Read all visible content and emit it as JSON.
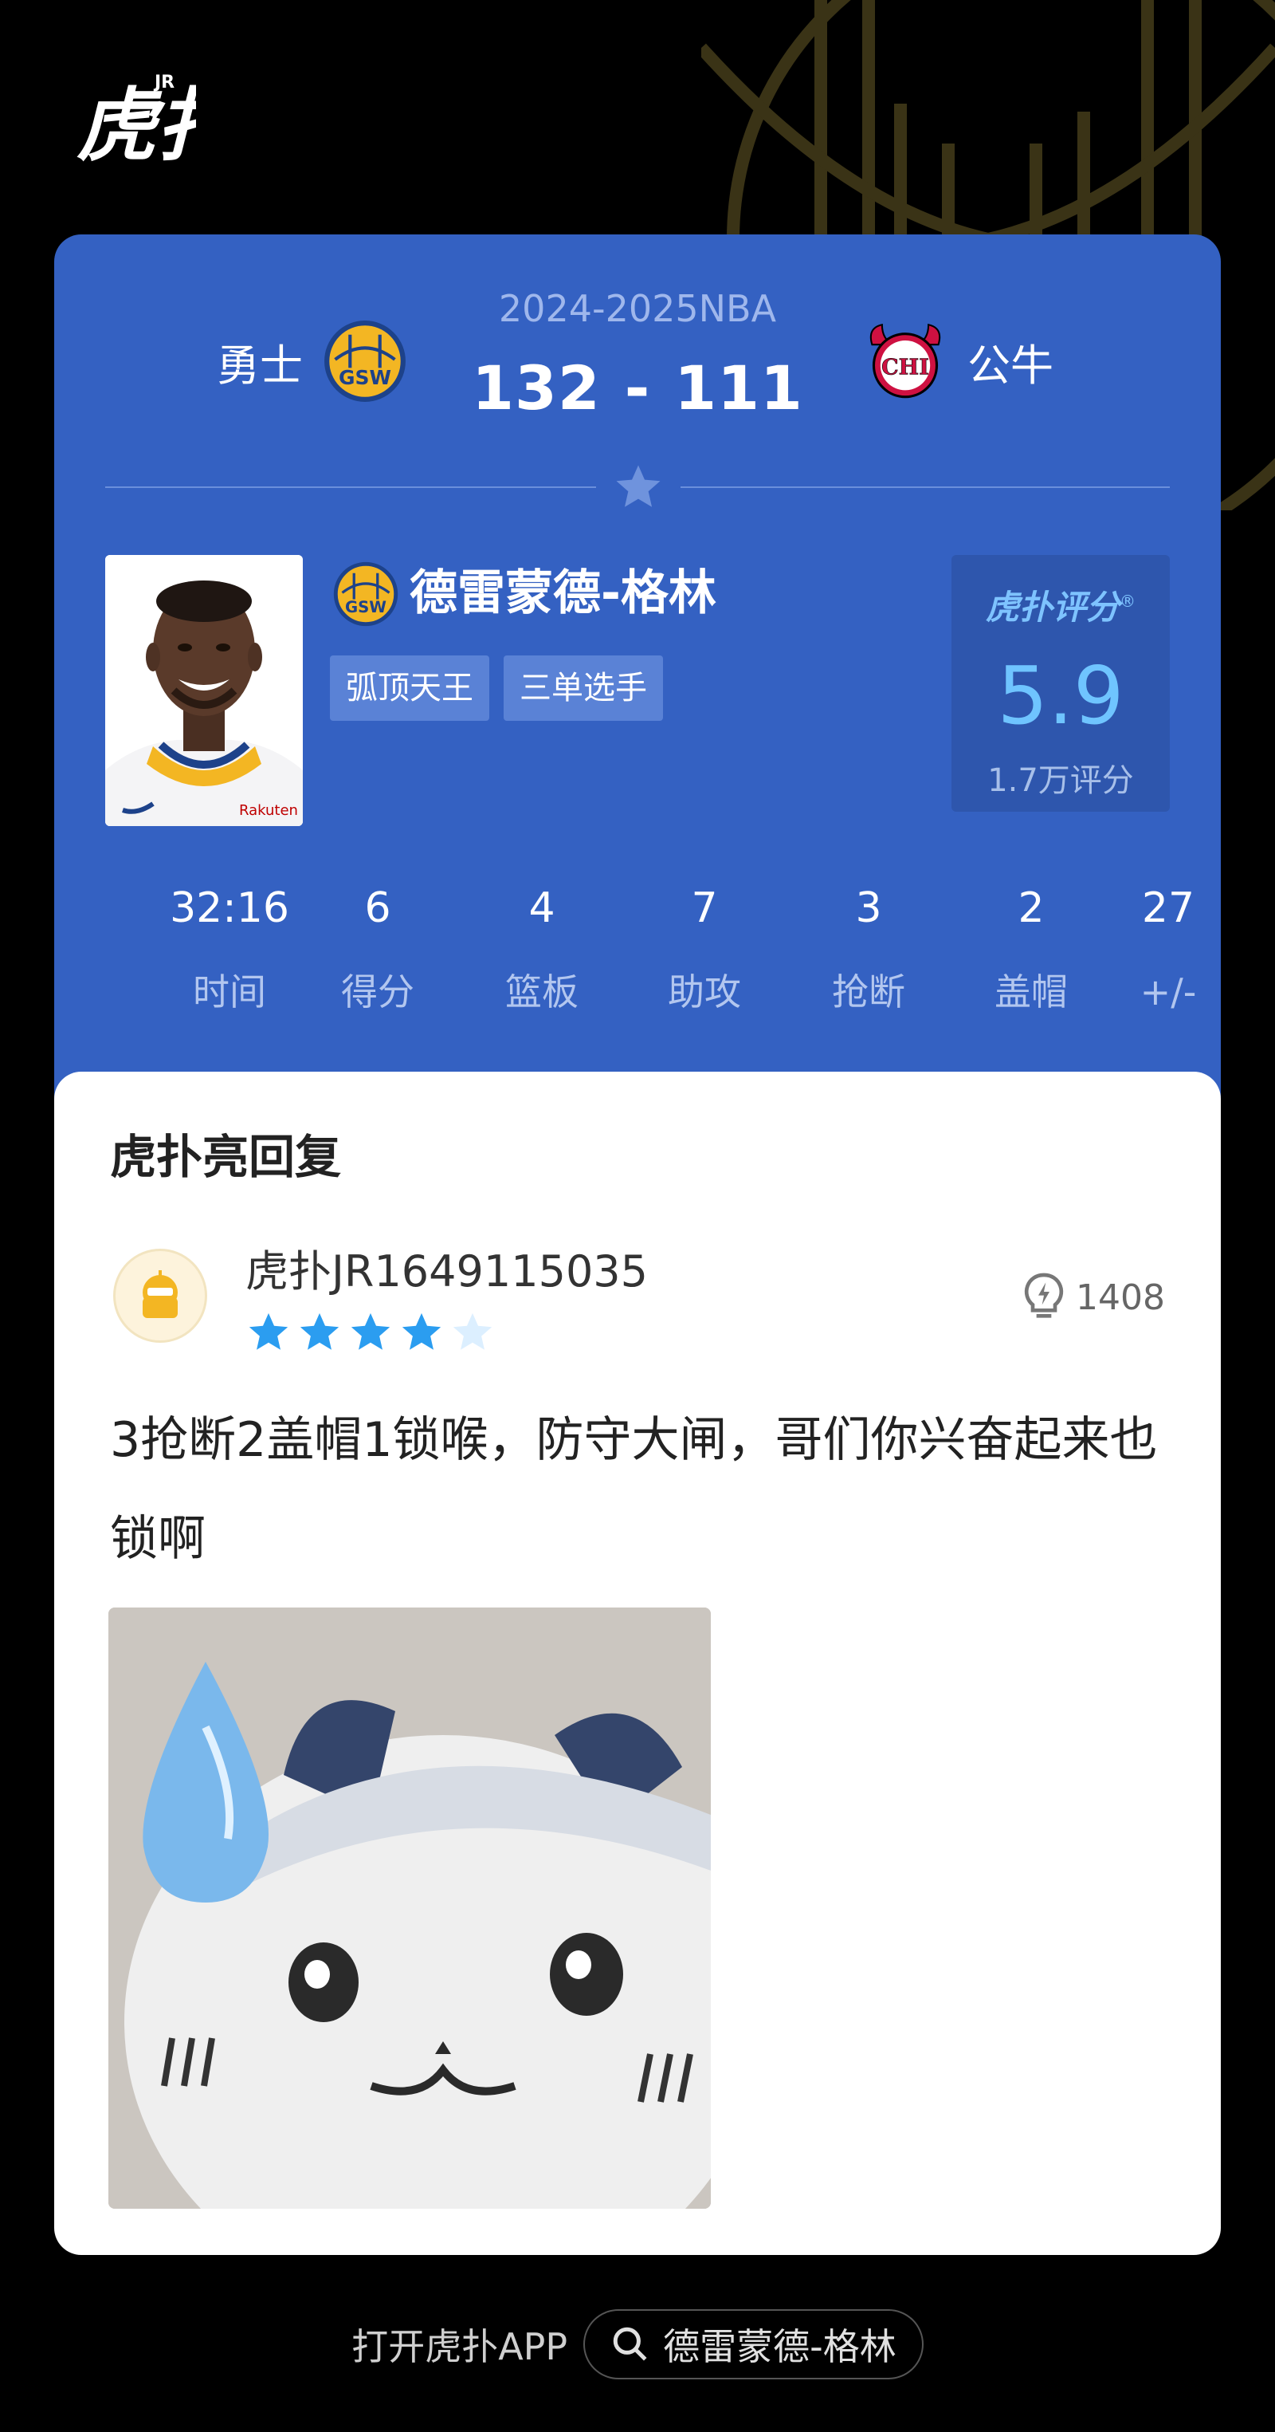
{
  "brand": {
    "logo_text": "虎扑",
    "logo_sup": "JR"
  },
  "match": {
    "home_team": "勇士",
    "home_abbr": "GSW",
    "away_team": "公牛",
    "away_abbr": "CHI",
    "season": "2024-2025NBA",
    "home_score": "132",
    "separator": "-",
    "away_score": "111"
  },
  "player": {
    "name": "德雷蒙德-格林",
    "team_abbr": "GSW",
    "tags": [
      "弧顶天王",
      "三单选手"
    ],
    "jersey_sponsor": "Rakuten"
  },
  "rating": {
    "brand": "虎扑评分",
    "registered": "®",
    "score": "5.9",
    "count": "1.7万评分"
  },
  "stats": [
    {
      "value": "32:16",
      "label": "时间"
    },
    {
      "value": "6",
      "label": "得分"
    },
    {
      "value": "4",
      "label": "篮板"
    },
    {
      "value": "7",
      "label": "助攻"
    },
    {
      "value": "3",
      "label": "抢断"
    },
    {
      "value": "2",
      "label": "盖帽"
    },
    {
      "value": "27",
      "label": "+/-"
    }
  ],
  "reply": {
    "section_title": "虎扑亮回复",
    "username": "虎扑JR1649115035",
    "star_rating": 4,
    "star_max": 5,
    "likes": "1408",
    "text": "3抢断2盖帽1锁喉，防守大闸，哥们你兴奋起来也锁啊"
  },
  "footer": {
    "open_app": "打开虎扑APP",
    "search_text": "德雷蒙德-格林"
  },
  "colors": {
    "card_blue": "#3461c2",
    "rating_blue": "#6fc4ff",
    "star_blue": "#2b9df0",
    "gsw_gold": "#f3b623",
    "chi_red": "#ce1141"
  },
  "icons": [
    "hupu-logo",
    "gsw-logo-icon",
    "chi-logo-icon",
    "star-icon",
    "lightbulb-icon",
    "search-icon"
  ]
}
